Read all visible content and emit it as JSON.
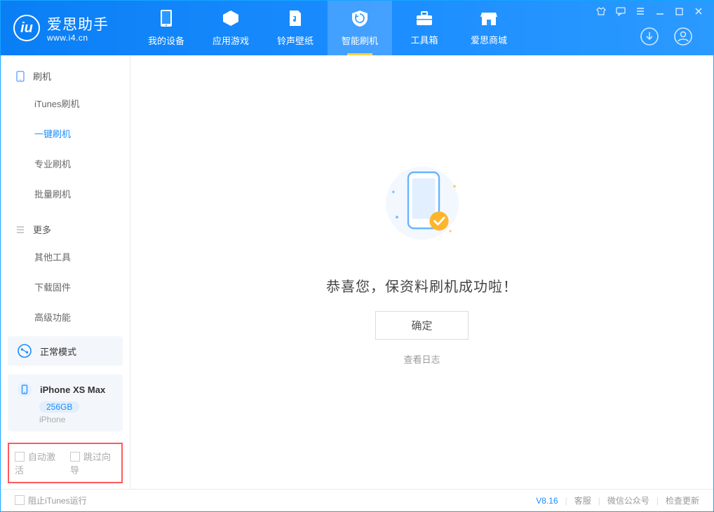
{
  "app": {
    "title": "爱思助手",
    "subtitle": "www.i4.cn"
  },
  "tabs": [
    {
      "label": "我的设备"
    },
    {
      "label": "应用游戏"
    },
    {
      "label": "铃声壁纸"
    },
    {
      "label": "智能刷机"
    },
    {
      "label": "工具箱"
    },
    {
      "label": "爱思商城"
    }
  ],
  "sidebar": {
    "section1": {
      "title": "刷机",
      "items": [
        {
          "label": "iTunes刷机"
        },
        {
          "label": "一键刷机"
        },
        {
          "label": "专业刷机"
        },
        {
          "label": "批量刷机"
        }
      ]
    },
    "section2": {
      "title": "更多",
      "items": [
        {
          "label": "其他工具"
        },
        {
          "label": "下载固件"
        },
        {
          "label": "高级功能"
        }
      ]
    },
    "mode": {
      "label": "正常模式"
    },
    "device": {
      "name": "iPhone XS Max",
      "storage": "256GB",
      "type": "iPhone"
    },
    "bottom_checks": {
      "auto_activate": "自动激活",
      "skip_guide": "跳过向导"
    }
  },
  "main": {
    "success_message": "恭喜您，保资料刷机成功啦！",
    "confirm_label": "确定",
    "log_link": "查看日志"
  },
  "footer": {
    "stop_itunes": "阻止iTunes运行",
    "version": "V8.16",
    "links": [
      "客服",
      "微信公众号",
      "检查更新"
    ]
  }
}
